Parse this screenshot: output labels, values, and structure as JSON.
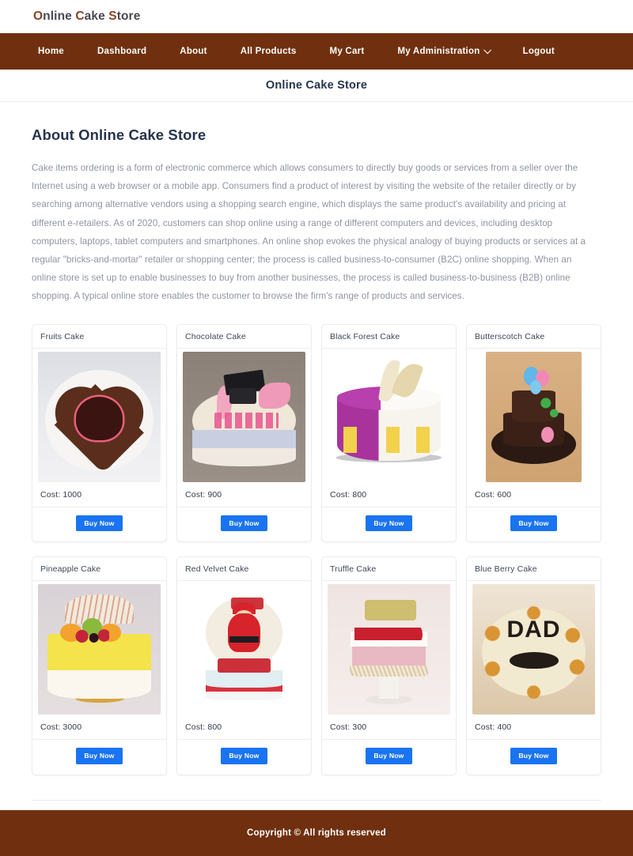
{
  "brand": {
    "text": "Online Cake Store",
    "caps": [
      "O",
      "C",
      "S"
    ],
    "accent_color": "#8a4326"
  },
  "nav": {
    "background_color": "#70300f",
    "items": [
      {
        "label": "Home",
        "has_dropdown": false
      },
      {
        "label": "Dashboard",
        "has_dropdown": false
      },
      {
        "label": "About",
        "has_dropdown": false
      },
      {
        "label": "All Products",
        "has_dropdown": false
      },
      {
        "label": "My Cart",
        "has_dropdown": false
      },
      {
        "label": "My Administration",
        "has_dropdown": true
      },
      {
        "label": "Logout",
        "has_dropdown": false
      }
    ]
  },
  "page_title": "Online Cake Store",
  "about": {
    "heading": "About Online Cake Store",
    "body": "Cake items ordering is a form of electronic commerce which allows consumers to directly buy goods or services from a seller over the Internet using a web browser or a mobile app. Consumers find a product of interest by visiting the website of the retailer directly or by searching among alternative vendors using a shopping search engine, which displays the same product's availability and pricing at different e-retailers. As of 2020, customers can shop online using a range of different computers and devices, including desktop computers, laptops, tablet computers and smartphones. An online shop evokes the physical analogy of buying products or services at a regular \"bricks-and-mortar\" retailer or shopping center; the process is called business-to-consumer (B2C) online shopping. When an online store is set up to enable businesses to buy from another businesses, the process is called business-to-business (B2B) online shopping. A typical online store enables the customer to browse the firm's range of products and services."
  },
  "products": {
    "cost_prefix": "Cost: ",
    "buy_label": "Buy Now",
    "buy_color": "#1a73f0",
    "items": [
      {
        "name": "Fruits Cake",
        "cost": "1000",
        "cost_label": "Cost: 1000",
        "art": "c-fruits",
        "inset": false
      },
      {
        "name": "Chocolate Cake",
        "cost": "900",
        "cost_label": "Cost: 900",
        "art": "c-choc",
        "inset": false
      },
      {
        "name": "Black Forest Cake",
        "cost": "800",
        "cost_label": "Cost: 800",
        "art": "c-bforest",
        "inset": false
      },
      {
        "name": "Butterscotch Cake",
        "cost": "600",
        "cost_label": "Cost: 600",
        "art": "c-butter",
        "inset": true
      },
      {
        "name": "Pineapple Cake",
        "cost": "3000",
        "cost_label": "Cost: 3000",
        "art": "c-pine",
        "inset": false
      },
      {
        "name": "Red Velvet Cake",
        "cost": "800",
        "cost_label": "Cost: 800",
        "art": "c-velvet",
        "inset": true
      },
      {
        "name": "Truffle Cake",
        "cost": "300",
        "cost_label": "Cost: 300",
        "art": "c-truffle",
        "inset": false
      },
      {
        "name": "Blue Berry Cake",
        "cost": "400",
        "cost_label": "Cost: 400",
        "art": "c-blue",
        "inset": false
      }
    ]
  },
  "footer": {
    "text": "Copyright © All rights reserved",
    "background_color": "#70300f"
  }
}
